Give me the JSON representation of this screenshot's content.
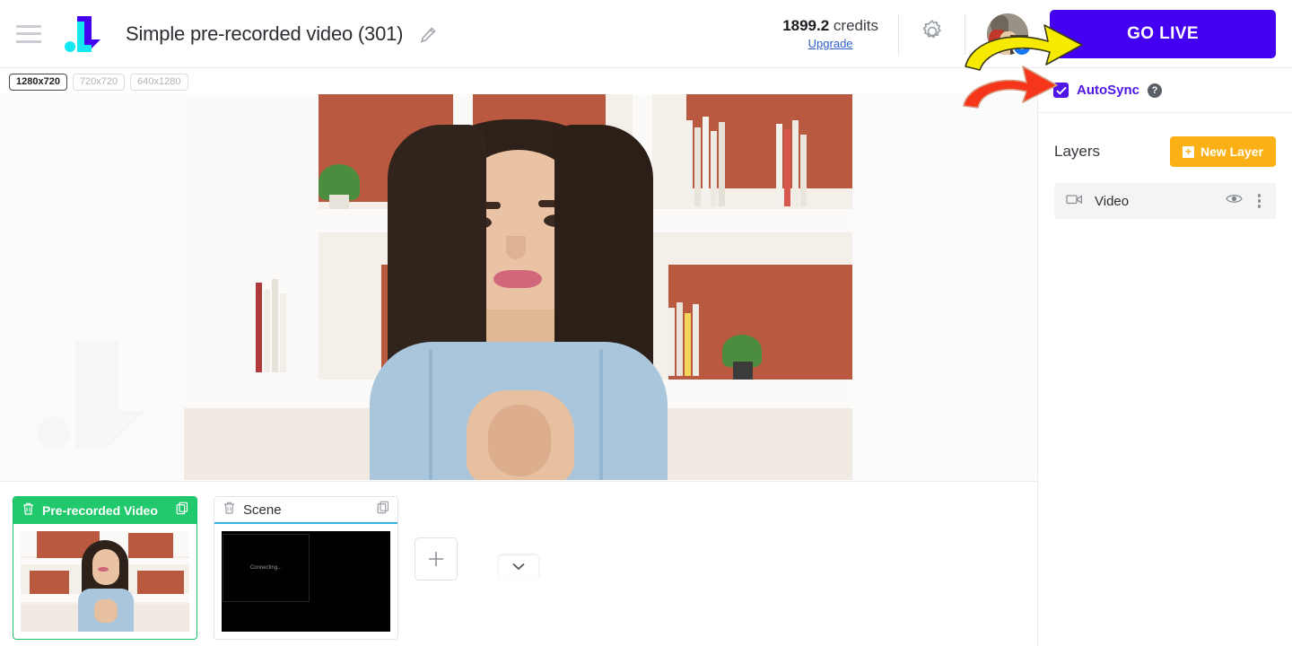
{
  "header": {
    "menu_icon": "hamburger-menu-icon",
    "logo_icon": "app-logo-icon",
    "project_title": "Simple pre-recorded video (301)",
    "edit_icon": "pencil-edit-icon",
    "credits_value": "1899.2",
    "credits_label": "credits",
    "upgrade_link": "Upgrade",
    "settings_icon": "gear-icon",
    "avatar": "user-avatar",
    "social_badge": "facebook-badge",
    "go_live_label": "GO LIVE"
  },
  "resolutions": [
    {
      "label": "1280x720",
      "active": true
    },
    {
      "label": "720x720",
      "active": false
    },
    {
      "label": "640x1280",
      "active": false
    }
  ],
  "preview": {
    "collapse_icon": "chevron-down-icon"
  },
  "scenes": {
    "cards": [
      {
        "name": "Pre-recorded Video",
        "active": true,
        "delete_icon": "trash-icon",
        "duplicate_icon": "copy-icon",
        "thumb_text": ""
      },
      {
        "name": "Scene",
        "active": false,
        "delete_icon": "trash-icon",
        "duplicate_icon": "copy-icon",
        "thumb_text": "Connecting..."
      }
    ],
    "add_label": "+"
  },
  "right_panel": {
    "autosync_label": "AutoSync",
    "autosync_checked": true,
    "help_icon": "question-mark-icon",
    "layers_title": "Layers",
    "new_layer_label": "New Layer",
    "layers": [
      {
        "name": "Video",
        "type_icon": "video-camera-icon",
        "visibility_icon": "eye-icon",
        "menu_icon": "kebab-menu-icon"
      }
    ]
  },
  "annotations": [
    {
      "name": "yellow-arrow-to-go-live",
      "color": "#f5ea00"
    },
    {
      "name": "red-arrow-to-autosync",
      "color": "#f5361a"
    }
  ],
  "colors": {
    "brand_purple": "#4400f0",
    "accent_violet": "#5016e8",
    "active_green": "#21c96c",
    "layer_orange": "#fbb016",
    "link_blue": "#2f5fd0",
    "scene_underline": "#35b6e0"
  }
}
